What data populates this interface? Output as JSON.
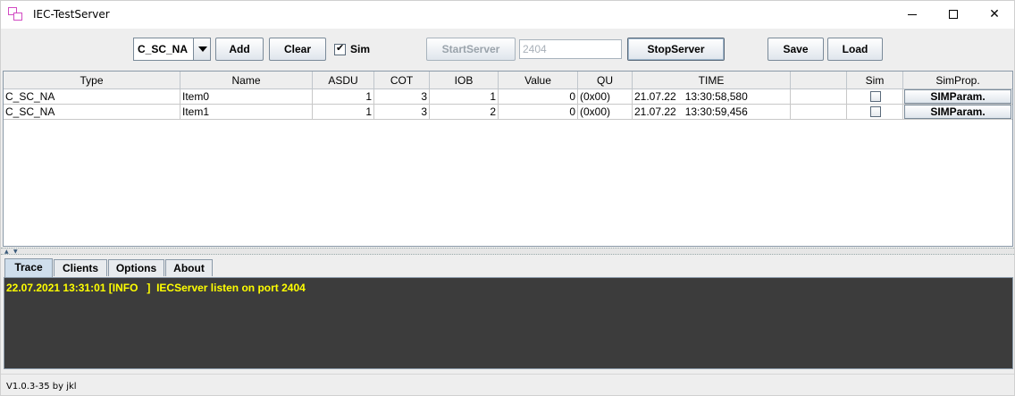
{
  "window": {
    "title": "IEC-TestServer",
    "min_glyph": "",
    "max_glyph": "",
    "close_glyph": "✕"
  },
  "toolbar": {
    "type_select": "C_SC_NA",
    "add_label": "Add",
    "clear_label": "Clear",
    "sim_label": "Sim",
    "sim_checked": true,
    "start_label": "StartServer",
    "port_value": "2404",
    "stop_label": "StopServer",
    "save_label": "Save",
    "load_label": "Load"
  },
  "table": {
    "headers": [
      "Type",
      "Name",
      "ASDU",
      "COT",
      "IOB",
      "Value",
      "QU",
      "TIME",
      "",
      "Sim",
      "SimProp."
    ],
    "rows": [
      {
        "type": "C_SC_NA",
        "name": "Item0",
        "asdu": "1",
        "cot": "3",
        "iob": "1",
        "value": "0",
        "qu": "(0x00)",
        "time": "21.07.22   13:30:58,580",
        "extra": "",
        "sim": false,
        "simprop": "SIMParam."
      },
      {
        "type": "C_SC_NA",
        "name": "Item1",
        "asdu": "1",
        "cot": "3",
        "iob": "2",
        "value": "0",
        "qu": "(0x00)",
        "time": "21.07.22   13:30:59,456",
        "extra": "",
        "sim": false,
        "simprop": "SIMParam."
      }
    ]
  },
  "tabs": [
    {
      "label": "Trace",
      "active": true
    },
    {
      "label": "Clients",
      "active": false
    },
    {
      "label": "Options",
      "active": false
    },
    {
      "label": "About",
      "active": false
    }
  ],
  "trace": {
    "lines": [
      "22.07.2021 13:31:01 [INFO   ]  IECServer listen on port 2404"
    ]
  },
  "status": {
    "version": "V1.0.3-35 by jkl"
  },
  "colors": {
    "trace_bg": "#3c3c3c",
    "trace_text": "#ffff00",
    "active_tab": "#cfdeec"
  }
}
